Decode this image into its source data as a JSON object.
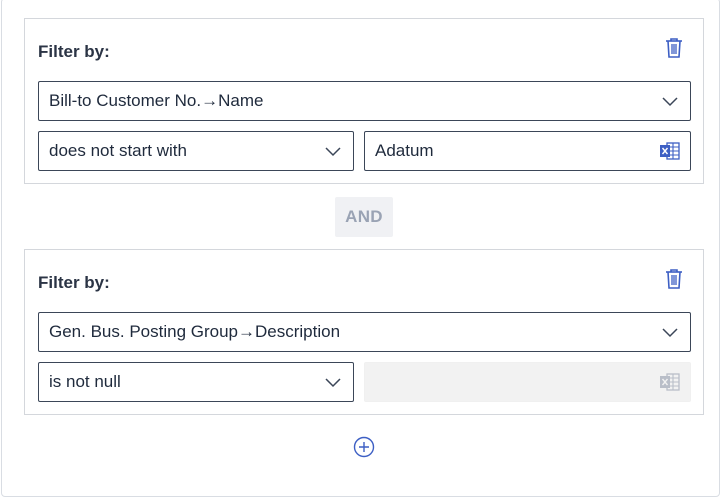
{
  "filters": [
    {
      "label": "Filter by:",
      "field": "Bill-to Customer No.→Name",
      "operator": "does not start with",
      "value": "Adatum",
      "value_disabled": false
    },
    {
      "label": "Filter by:",
      "field": "Gen. Bus. Posting Group→Description",
      "operator": "is not null",
      "value": "",
      "value_disabled": true
    }
  ],
  "conjunction": "AND",
  "icons": {
    "delete": "trash-icon",
    "dropdown": "chevron-down-icon",
    "excel": "excel-icon",
    "add": "add-circle-icon"
  },
  "colors": {
    "accent": "#3d5fc4",
    "border": "#3b4658",
    "disabled_text": "#9aa3b4"
  }
}
